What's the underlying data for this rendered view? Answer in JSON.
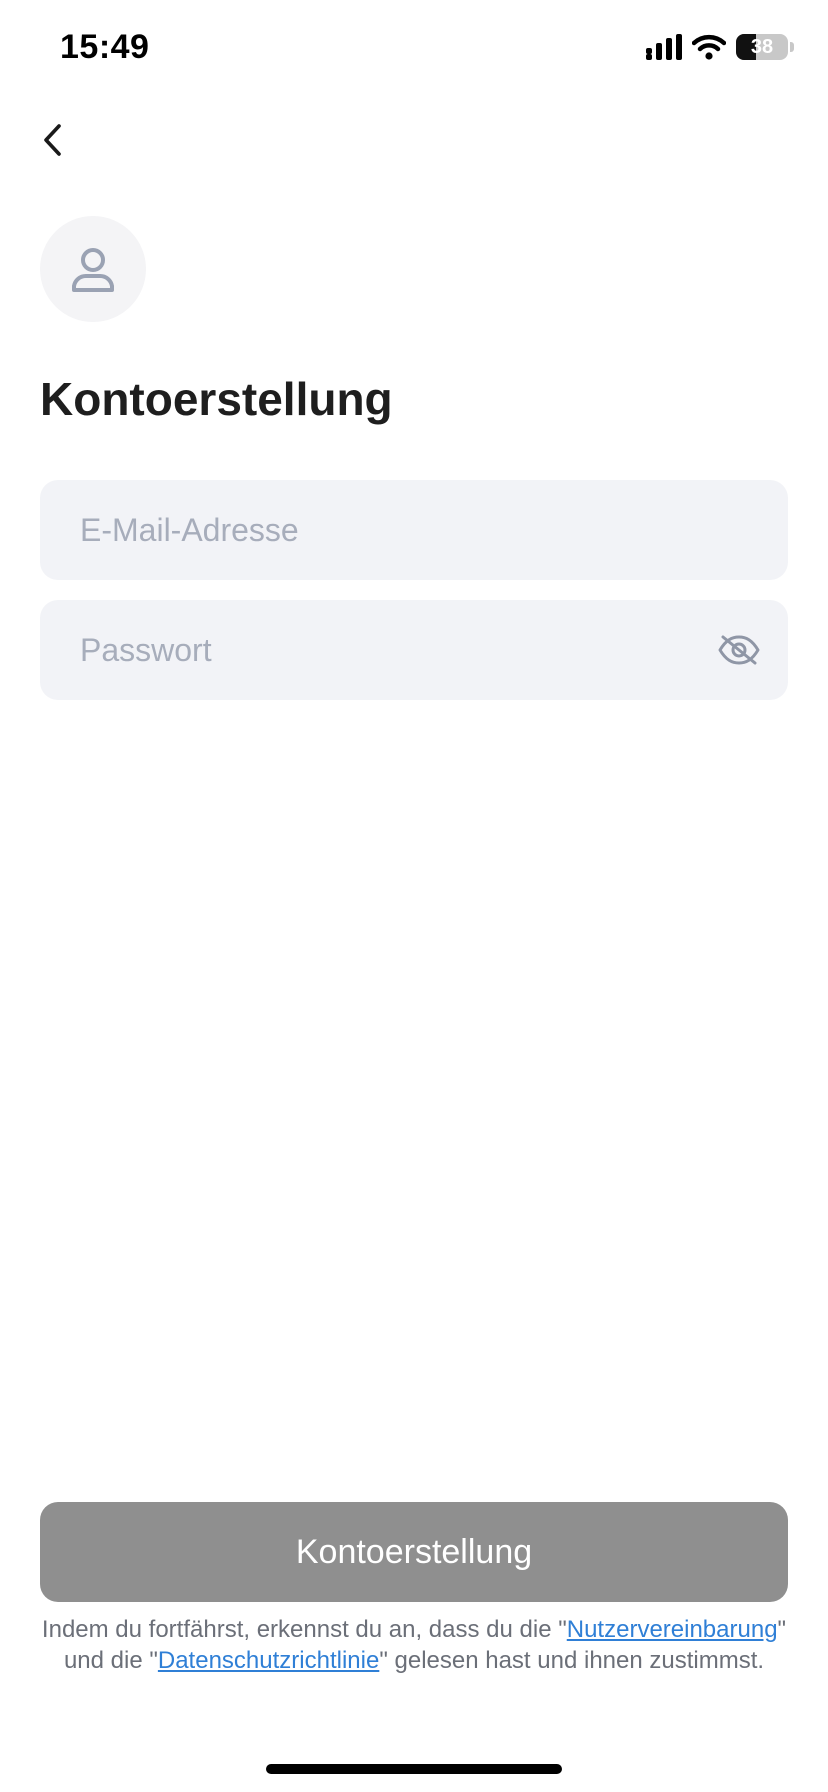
{
  "status_bar": {
    "time": "15:49",
    "battery_level": "38",
    "battery_fraction": 0.38
  },
  "header": {
    "back_icon": "chevron-left-icon"
  },
  "avatar": {
    "icon": "user-icon"
  },
  "page": {
    "title": "Kontoerstellung"
  },
  "form": {
    "email_placeholder": "E-Mail-Adresse",
    "email_value": "",
    "password_placeholder": "Passwort",
    "password_value": "",
    "password_toggle_icon": "eye-slash-icon"
  },
  "submit": {
    "label": "Kontoerstellung"
  },
  "legal": {
    "prefix": "Indem du fortfährst, erkennst du an, dass du die \"",
    "user_agreement_link": "Nutzervereinbarung",
    "middle": "\" und die \"",
    "privacy_link": "Datenschutzrichtlinie",
    "suffix": "\" gelesen hast und ihnen zustimmst."
  },
  "colors": {
    "field_background": "#f2f3f7",
    "placeholder": "#a7adbb",
    "button_disabled": "#8f8f8f",
    "link": "#2f7fd6"
  }
}
